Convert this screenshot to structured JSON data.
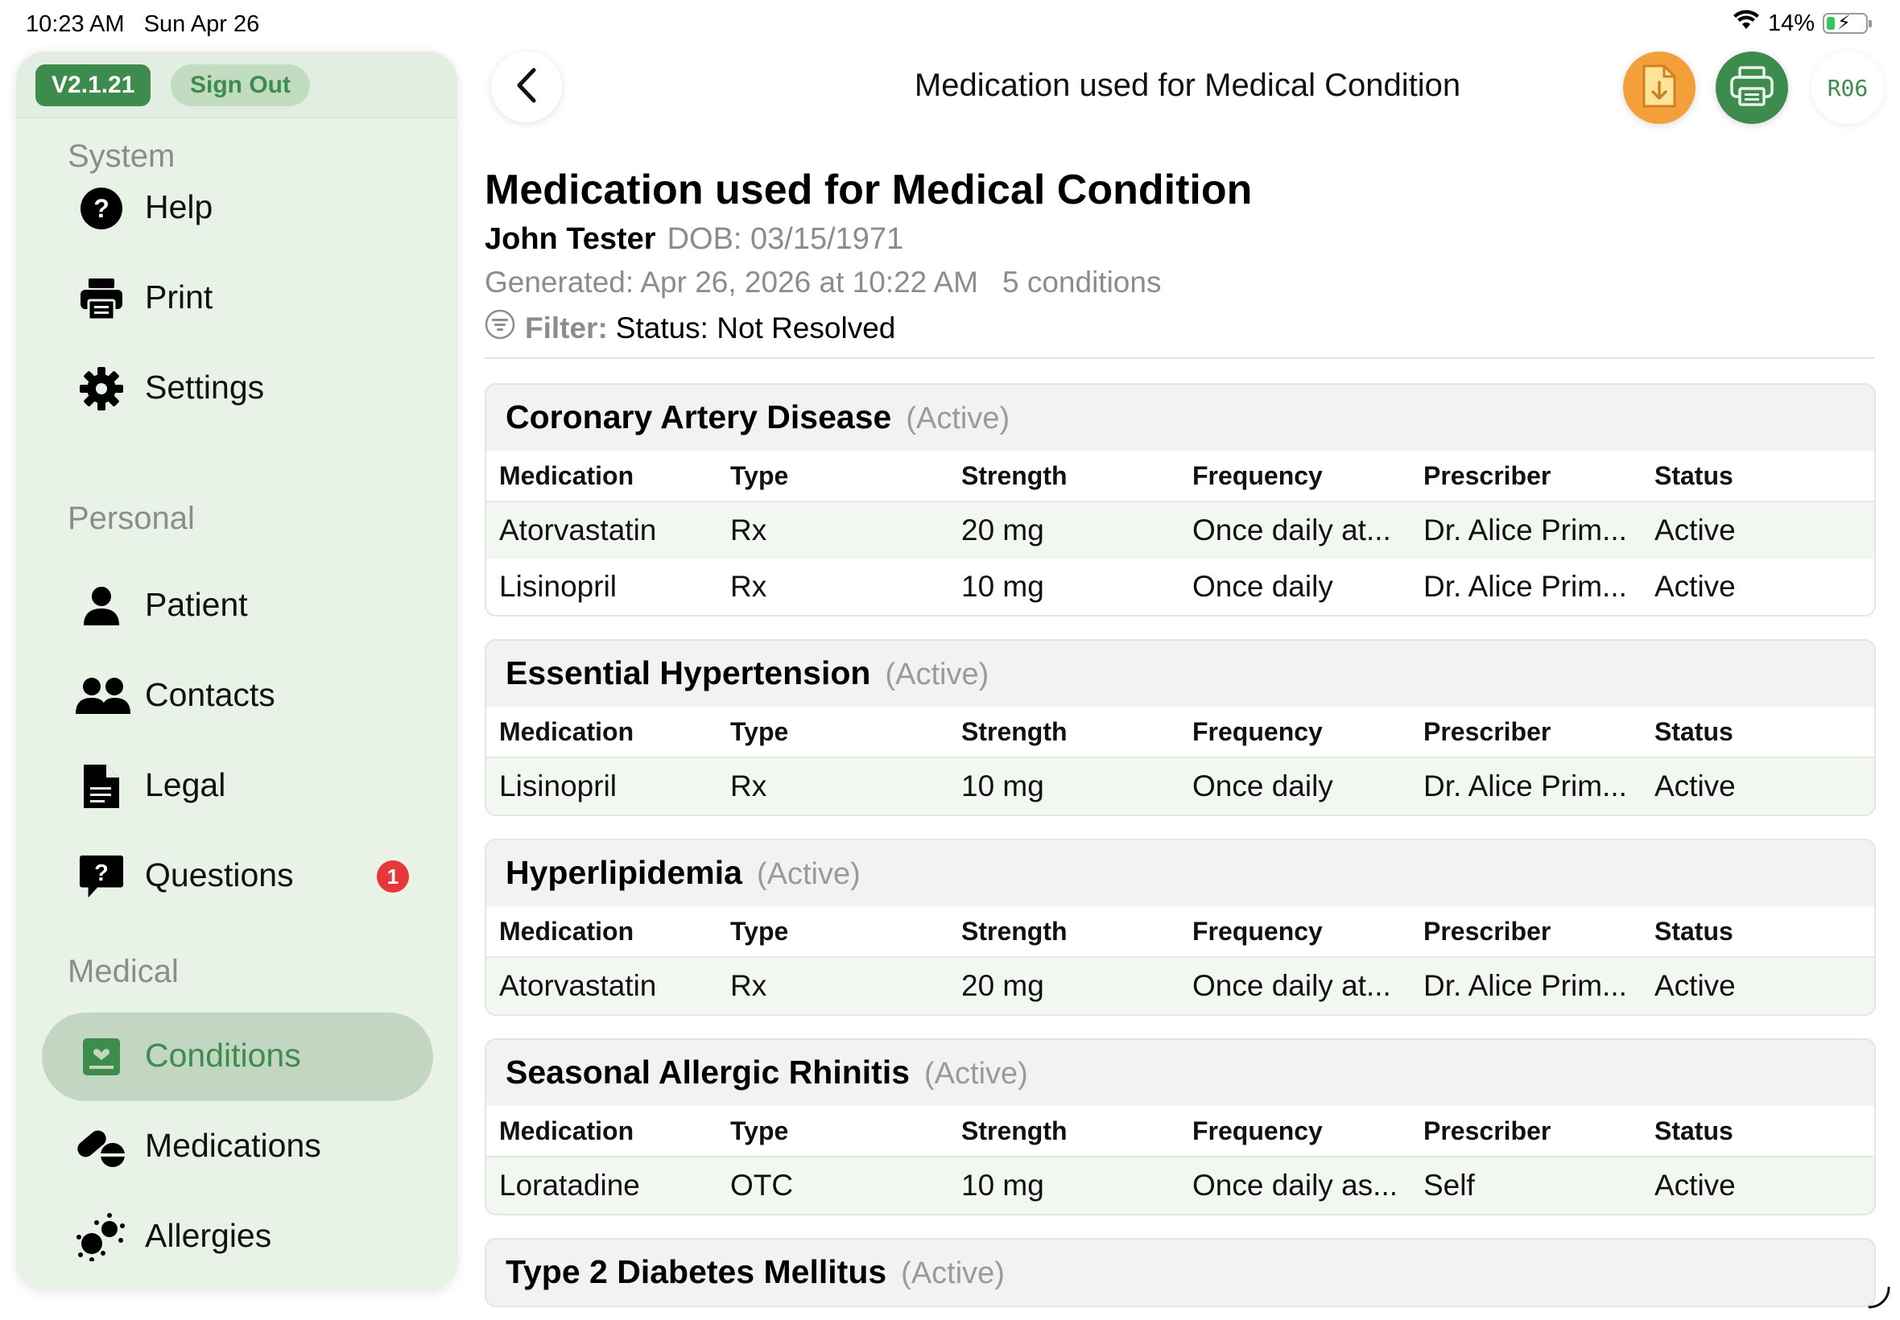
{
  "status_bar": {
    "time": "10:23 AM",
    "date": "Sun Apr 26",
    "battery": "14%"
  },
  "sidebar": {
    "version": "V2.1.21",
    "sign_out": "Sign Out",
    "sections": [
      {
        "title": "System",
        "items": [
          {
            "label": "Help",
            "icon": "help-icon"
          },
          {
            "label": "Print",
            "icon": "print-icon"
          },
          {
            "label": "Settings",
            "icon": "gear-icon"
          }
        ]
      },
      {
        "title": "Personal",
        "items": [
          {
            "label": "Patient",
            "icon": "person-icon"
          },
          {
            "label": "Contacts",
            "icon": "people-icon"
          },
          {
            "label": "Legal",
            "icon": "document-icon"
          },
          {
            "label": "Questions",
            "icon": "question-bubble-icon",
            "badge": "1"
          }
        ]
      },
      {
        "title": "Medical",
        "items": [
          {
            "label": "Conditions",
            "icon": "conditions-icon",
            "active": true
          },
          {
            "label": "Medications",
            "icon": "pills-icon"
          },
          {
            "label": "Allergies",
            "icon": "allergens-icon"
          }
        ]
      }
    ]
  },
  "header": {
    "title": "Medication used for Medical Condition",
    "user_code": "R06"
  },
  "report": {
    "title": "Medication used for Medical Condition",
    "patient_name": "John Tester",
    "dob": "DOB: 03/15/1971",
    "generated": "Generated: Apr 26, 2026 at 10:22 AM",
    "count": "5 conditions",
    "filter_label": "Filter:",
    "filter_value": "Status: Not Resolved"
  },
  "columns": [
    "Medication",
    "Type",
    "Strength",
    "Frequency",
    "Prescriber",
    "Status"
  ],
  "conditions": [
    {
      "name": "Coronary Artery Disease",
      "status": "(Active)",
      "rows": [
        [
          "Atorvastatin",
          "Rx",
          "20 mg",
          "Once daily at...",
          "Dr. Alice Prim...",
          "Active"
        ],
        [
          "Lisinopril",
          "Rx",
          "10 mg",
          "Once daily",
          "Dr. Alice Prim...",
          "Active"
        ]
      ]
    },
    {
      "name": "Essential Hypertension",
      "status": "(Active)",
      "rows": [
        [
          "Lisinopril",
          "Rx",
          "10 mg",
          "Once daily",
          "Dr. Alice Prim...",
          "Active"
        ]
      ]
    },
    {
      "name": "Hyperlipidemia",
      "status": "(Active)",
      "rows": [
        [
          "Atorvastatin",
          "Rx",
          "20 mg",
          "Once daily at...",
          "Dr. Alice Prim...",
          "Active"
        ]
      ]
    },
    {
      "name": "Seasonal Allergic Rhinitis",
      "status": "(Active)",
      "rows": [
        [
          "Loratadine",
          "OTC",
          "10 mg",
          "Once daily as...",
          "Self",
          "Active"
        ]
      ]
    },
    {
      "name": "Type 2 Diabetes Mellitus",
      "status": "(Active)",
      "rows": []
    }
  ],
  "colors": {
    "accent_green": "#3e8b4e",
    "sidebar_bg": "#e8f2e7",
    "pdf_orange": "#f3a03b",
    "badge_red": "#e5383b"
  }
}
